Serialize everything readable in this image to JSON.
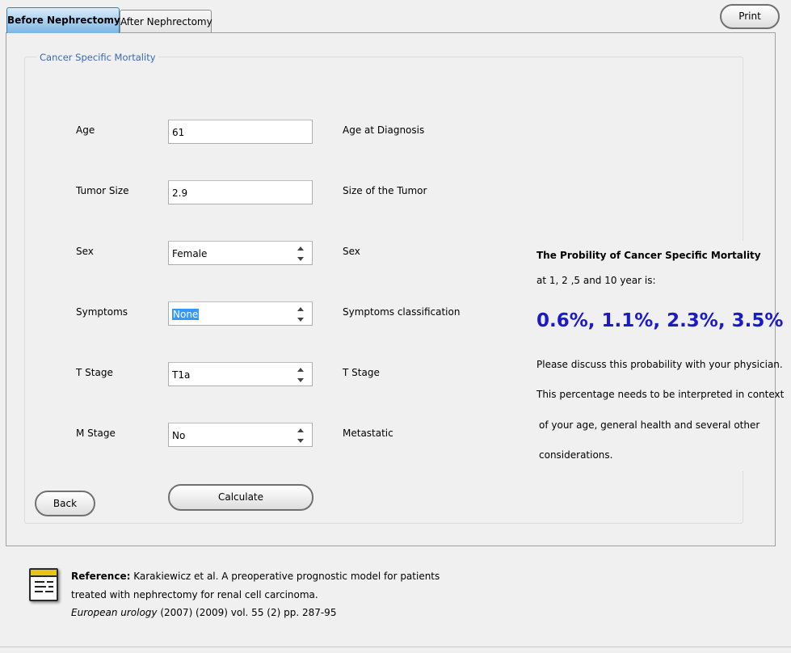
{
  "tabs": {
    "before": "Before Nephrectomy",
    "after": "After Nephrectomy"
  },
  "print_label": "Print",
  "group_title": "Cancer Specific Mortality",
  "fields": {
    "age": {
      "label": "Age",
      "value": "61",
      "desc": "Age at Diagnosis"
    },
    "tumor": {
      "label": "Tumor Size",
      "value": "2.9",
      "desc": "Size of the Tumor"
    },
    "sex": {
      "label": "Sex",
      "value": "Female",
      "desc": "Sex"
    },
    "symptoms": {
      "label": "Symptoms",
      "value": "None",
      "desc": "Symptoms classification"
    },
    "tstage": {
      "label": "T Stage",
      "value": "T1a",
      "desc": "T Stage"
    },
    "mstage": {
      "label": "M Stage",
      "value": "No",
      "desc": "Metastatic"
    }
  },
  "buttons": {
    "back": "Back",
    "calculate": "Calculate"
  },
  "result": {
    "title": "The Probility of Cancer Specific Mortality",
    "subtitle": "at 1, 2 ,5 and 10 year is:",
    "value": "0.6%, 1.1%, 2.3%, 3.5%",
    "line1": "Please discuss this probability with your physician.",
    "line2": "This percentage needs to be interpreted in context",
    "line3": "of your age, general health and several other",
    "line4": "considerations.",
    "value_color": "#1a1acc"
  },
  "reference": {
    "label": "Reference:",
    "text1": "Karakiewicz et al. A preoperative prognostic model for patients",
    "text2": "treated with nephrectomy for renal cell carcinoma.",
    "journal": "European urology",
    "text3": "(2007) (2009) vol. 55 (2) pp. 287-95",
    "icon": "document-icon"
  }
}
